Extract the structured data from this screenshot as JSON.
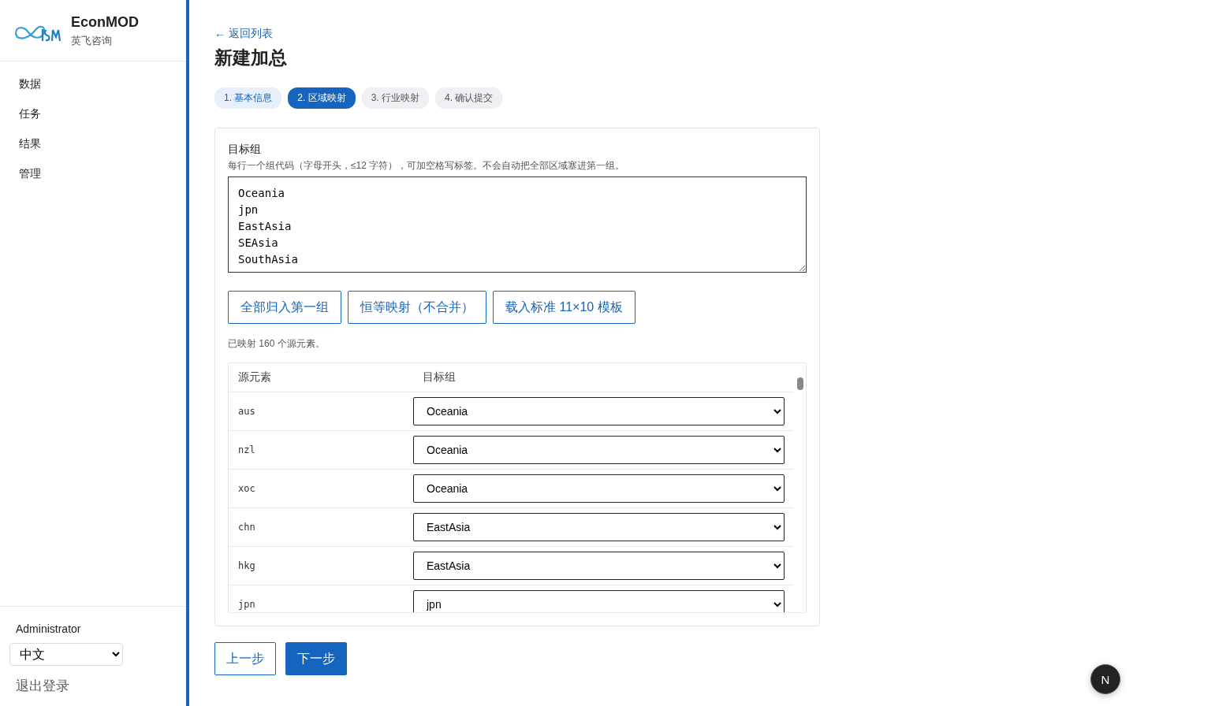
{
  "brand": {
    "name": "EconMOD",
    "subtitle": "英飞咨询"
  },
  "nav": [
    {
      "label": "数据"
    },
    {
      "label": "任务"
    },
    {
      "label": "结果"
    },
    {
      "label": "管理"
    }
  ],
  "user": {
    "name": "Administrator",
    "language": "中文",
    "logout": "退出登录"
  },
  "back_link": "← 返回列表",
  "title": "新建加总",
  "steps": [
    {
      "label": "1. 基本信息",
      "selected": false,
      "done": true
    },
    {
      "label": "2. 区域映射",
      "selected": true,
      "done": false
    },
    {
      "label": "3. 行业映射",
      "selected": false,
      "done": false
    },
    {
      "label": "4. 确认提交",
      "selected": false,
      "done": false
    }
  ],
  "groups": {
    "label": "目标组",
    "hint": "每行一个组代码（字母开头，≤12 字符），可加空格写标签。不会自动把全部区域塞进第一组。",
    "value": "Oceania\njpn\nEastAsia\nSEAsia\nSouthAsia"
  },
  "actions": [
    "全部归入第一组",
    "恒等映射（不合并）",
    "载入标准 11×10 模板"
  ],
  "mapped_note": "已映射 160 个源元素。",
  "table": {
    "columns": [
      "源元素",
      "目标组"
    ],
    "rows": [
      {
        "source": "aus",
        "target": "Oceania"
      },
      {
        "source": "nzl",
        "target": "Oceania"
      },
      {
        "source": "xoc",
        "target": "Oceania"
      },
      {
        "source": "chn",
        "target": "EastAsia"
      },
      {
        "source": "hkg",
        "target": "EastAsia"
      },
      {
        "source": "jpn",
        "target": "jpn"
      }
    ]
  },
  "footer_buttons": [
    {
      "label": "上一步",
      "kind": "secondary"
    },
    {
      "label": "下一步",
      "kind": "primary"
    }
  ],
  "badge": "N"
}
